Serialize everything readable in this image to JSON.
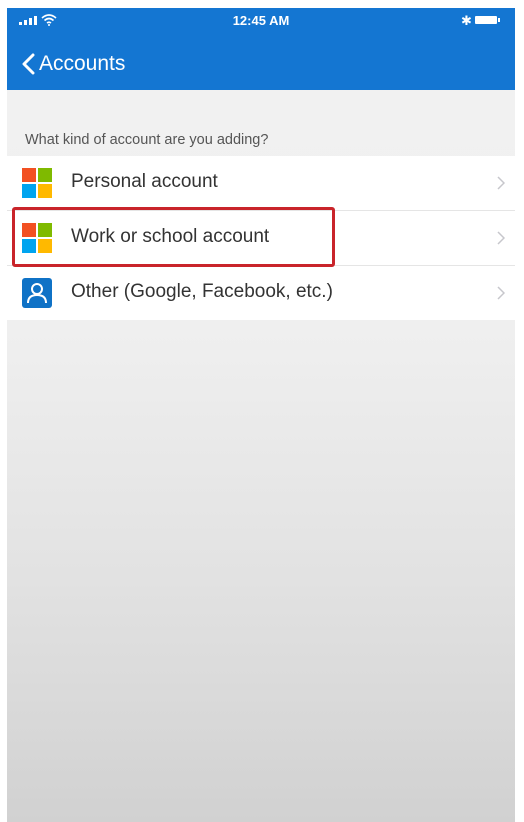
{
  "status_bar": {
    "time": "12:45 AM",
    "bluetooth_glyph": "✱"
  },
  "nav": {
    "back_label": "Accounts",
    "back_icon": "chevron-left-icon"
  },
  "prompt": "What kind of account are you adding?",
  "options": [
    {
      "label": "Personal account",
      "icon": "microsoft-logo-icon"
    },
    {
      "label": "Work or school account",
      "icon": "microsoft-logo-icon",
      "highlighted": true
    },
    {
      "label": "Other (Google, Facebook, etc.)",
      "icon": "person-icon"
    }
  ],
  "colors": {
    "header_blue": "#1476d2",
    "highlight_red": "#c9242a",
    "ms_red": "#f25022",
    "ms_green": "#7fba00",
    "ms_blue": "#00a4ef",
    "ms_yellow": "#ffb900",
    "person_icon_bg": "#0f72c6"
  }
}
